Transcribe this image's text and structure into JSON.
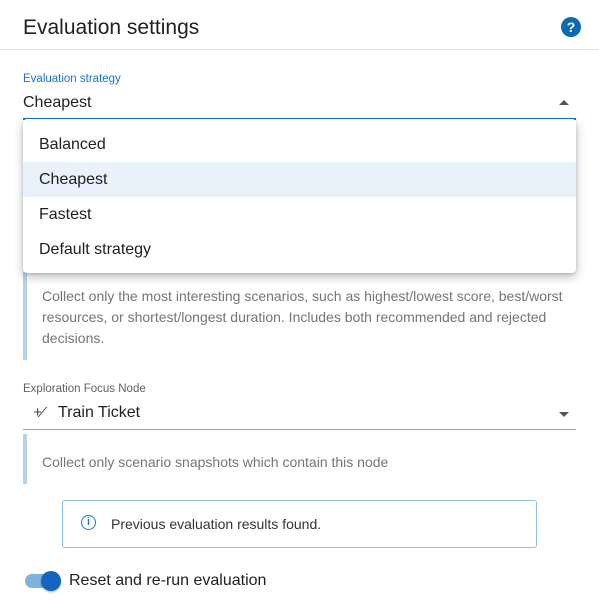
{
  "header": {
    "title": "Evaluation settings",
    "help_glyph": "?"
  },
  "strategy": {
    "label": "Evaluation strategy",
    "value": "Cheapest",
    "options": [
      "Balanced",
      "Cheapest",
      "Fastest",
      "Default strategy"
    ],
    "selected_index": 1,
    "description": "Collect only the most interesting scenarios, such as highest/lowest score, best/worst resources, or shortest/longest duration. Includes both recommended and rejected decisions."
  },
  "focus": {
    "label": "Exploration Focus Node",
    "icon_glyph": "+⁄",
    "value": "Train Ticket",
    "description": "Collect only scenario snapshots which contain this node"
  },
  "alert": {
    "icon_glyph": "i",
    "text": "Previous evaluation results found."
  },
  "toggle": {
    "label": "Reset and re-run evaluation",
    "checked": true
  },
  "colors": {
    "accent": "#1976d2",
    "help_icon": "#0b6bb0",
    "selected_option_bg": "#e9f2fa",
    "description_border": "#b3d4ee"
  },
  "icons": [
    "help-circle-icon",
    "arrow-up-icon",
    "arrow-down-icon",
    "node-icon",
    "info-icon"
  ]
}
